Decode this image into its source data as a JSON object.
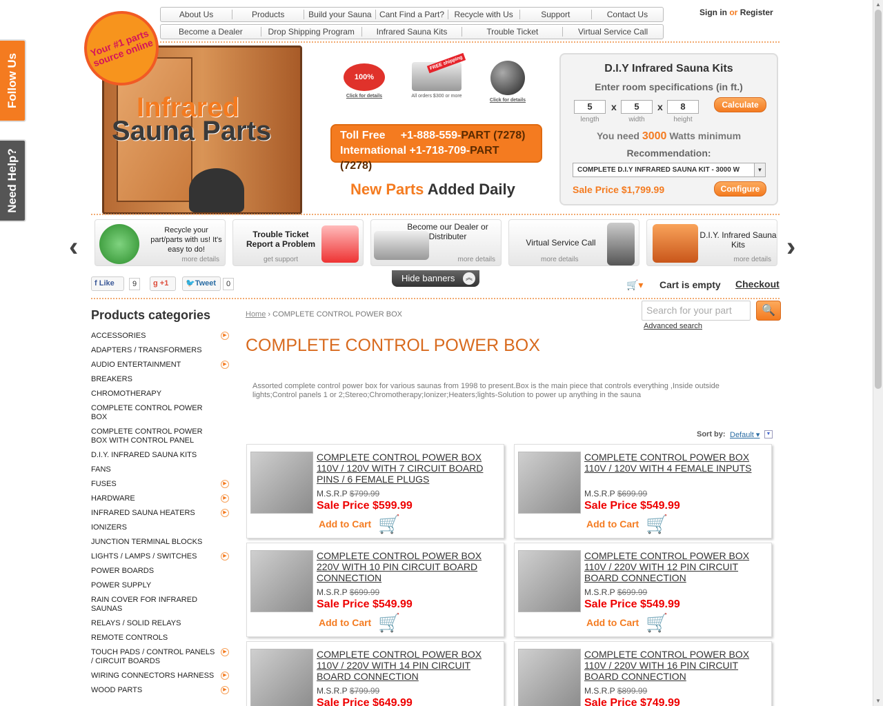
{
  "side_tabs": {
    "follow": "Follow Us",
    "help": "Need Help?"
  },
  "nav": {
    "row1": [
      "About Us",
      "Products",
      "Build your Sauna",
      "Cant Find a Part?",
      "Recycle with Us",
      "Support",
      "Contact Us"
    ],
    "row2": [
      "Become a Dealer",
      "Drop Shipping Program",
      "Infrared Sauna Kits",
      "Trouble Ticket",
      "Virtual Service Call"
    ]
  },
  "account": {
    "signin": "Sign in",
    "or": "or",
    "register": "Register"
  },
  "logo": {
    "star": "Your #1 parts source online",
    "line1": "Infrared",
    "line2": "Sauna Parts"
  },
  "badges": [
    {
      "pic": "100%",
      "caption": "Click for details",
      "icon": "guarantee-icon"
    },
    {
      "pic": "FREE shipping",
      "caption": "All orders $300 or more",
      "icon": "truck-icon"
    },
    {
      "pic": "we ship worldwide",
      "caption": "Click for details",
      "icon": "globe-icon"
    }
  ],
  "phones": {
    "tollfree_label": "Toll Free",
    "tollfree_num": "+1-888-559-",
    "tollfree_part": "PART (7278)",
    "intl_label": "International",
    "intl_num": "+1-718-709-",
    "intl_part": "PART (7278)"
  },
  "new_parts": {
    "a": "New Parts",
    "b": "Added Daily"
  },
  "diy": {
    "title": "D.I.Y Infrared Sauna Kits",
    "subtitle": "Enter room specifications (in ft.)",
    "length": "5",
    "width": "5",
    "height": "8",
    "length_label": "length",
    "width_label": "width",
    "height_label": "height",
    "x": "x",
    "calculate": "Calculate",
    "need_a": "You need",
    "watts": "3000",
    "need_b": "Watts minimum",
    "recommendation": "Recommendation:",
    "kit": "COMPLETE D.I.Y INFRARED SAUNA KIT - 3000 W",
    "sale_price": "Sale Price $1,799.99",
    "configure": "Configure"
  },
  "banners": [
    {
      "text": "Recycle your part/parts with us! It's easy to do!",
      "more": "more details"
    },
    {
      "text": "Trouble Ticket Report a Problem",
      "more": "get support"
    },
    {
      "text": "Become our Dealer or Distributer",
      "more": "more details"
    },
    {
      "text": "Virtual Service Call",
      "more": "more details"
    },
    {
      "text": "D.I.Y. Infrared Sauna Kits",
      "more": "more details"
    }
  ],
  "hide_banners": "Hide banners",
  "social": {
    "like": "Like",
    "like_count": "9",
    "plus": "+1",
    "tweet": "Tweet",
    "tweet_count": "0"
  },
  "cart": {
    "status": "Cart is empty",
    "checkout": "Checkout"
  },
  "categories_title": "Products categories",
  "categories": [
    {
      "label": "ACCESSORIES",
      "arrow": true
    },
    {
      "label": "ADAPTERS / TRANSFORMERS",
      "arrow": false
    },
    {
      "label": "AUDIO ENTERTAINMENT",
      "arrow": true
    },
    {
      "label": "BREAKERS",
      "arrow": false
    },
    {
      "label": "CHROMOTHERAPY",
      "arrow": false
    },
    {
      "label": "COMPLETE CONTROL POWER BOX",
      "arrow": false
    },
    {
      "label": "COMPLETE CONTROL POWER BOX WITH CONTROL PANEL",
      "arrow": false
    },
    {
      "label": "D.I.Y. INFRARED SAUNA KITS",
      "arrow": false
    },
    {
      "label": "FANS",
      "arrow": false
    },
    {
      "label": "FUSES",
      "arrow": true
    },
    {
      "label": "HARDWARE",
      "arrow": true
    },
    {
      "label": "INFRARED SAUNA HEATERS",
      "arrow": true
    },
    {
      "label": "IONIZERS",
      "arrow": false
    },
    {
      "label": "JUNCTION TERMINAL BLOCKS",
      "arrow": false
    },
    {
      "label": "LIGHTS / LAMPS / SWITCHES",
      "arrow": true
    },
    {
      "label": "POWER BOARDS",
      "arrow": false
    },
    {
      "label": "POWER SUPPLY",
      "arrow": false
    },
    {
      "label": "RAIN COVER FOR INFRARED SAUNAS",
      "arrow": false
    },
    {
      "label": "RELAYS / SOLID RELAYS",
      "arrow": false
    },
    {
      "label": "REMOTE CONTROLS",
      "arrow": false
    },
    {
      "label": "TOUCH PADS / CONTROL PANELS / CIRCUIT BOARDS",
      "arrow": true
    },
    {
      "label": "WIRING CONNECTORS HARNESS",
      "arrow": true
    },
    {
      "label": "WOOD PARTS",
      "arrow": true
    }
  ],
  "breadcrumb": {
    "home": "Home",
    "current": "COMPLETE CONTROL POWER BOX"
  },
  "search": {
    "placeholder": "Search for your part",
    "advanced": "Advanced search"
  },
  "page_title": "COMPLETE CONTROL POWER BOX",
  "description": "Assorted complete control power box for various saunas from 1998 to present.Box is the main piece that controls everything ,Inside outside lights;Control panels 1 or 2;Stereo;Chromotherapy;Ionizer;Heaters;lights-Solution to power up anything in the sauna",
  "sort": {
    "label": "Sort by:",
    "value": "Default"
  },
  "products": [
    {
      "name": "COMPLETE CONTROL POWER BOX 110V / 120V WITH 7 CIRCUIT BOARD PINS / 6 FEMALE PLUGS",
      "msrp_label": "M.S.R.P",
      "msrp": "$799.99",
      "sale_label": "Sale Price",
      "sale": "$599.99",
      "add": "Add to Cart"
    },
    {
      "name": "COMPLETE CONTROL POWER BOX 110V / 120V WITH 4 FEMALE INPUTS",
      "msrp_label": "M.S.R.P",
      "msrp": "$699.99",
      "sale_label": "Sale Price",
      "sale": "$549.99",
      "add": "Add to Cart"
    },
    {
      "name": "COMPLETE CONTROL POWER BOX 220V WITH 10 PIN CIRCUIT BOARD CONNECTION",
      "msrp_label": "M.S.R.P",
      "msrp": "$699.99",
      "sale_label": "Sale Price",
      "sale": "$549.99",
      "add": "Add to Cart"
    },
    {
      "name": "COMPLETE CONTROL POWER BOX 110V / 220V WITH 12 PIN CIRCUIT BOARD CONNECTION",
      "msrp_label": "M.S.R.P",
      "msrp": "$699.99",
      "sale_label": "Sale Price",
      "sale": "$549.99",
      "add": "Add to Cart"
    },
    {
      "name": "COMPLETE CONTROL POWER BOX 110V / 220V WITH 14 PIN CIRCUIT BOARD CONNECTION",
      "msrp_label": "M.S.R.P",
      "msrp": "$799.99",
      "sale_label": "Sale Price",
      "sale": "$649.99",
      "add": "Add to Cart"
    },
    {
      "name": "COMPLETE CONTROL POWER BOX 110V / 220V WITH 16 PIN CIRCUIT BOARD CONNECTION",
      "msrp_label": "M.S.R.P",
      "msrp": "$899.99",
      "sale_label": "Sale Price",
      "sale": "$749.99",
      "add": "Add to Cart"
    }
  ],
  "colors": {
    "accent": "#f47b20",
    "sale": "#ee0000",
    "title": "#d86a1e"
  }
}
